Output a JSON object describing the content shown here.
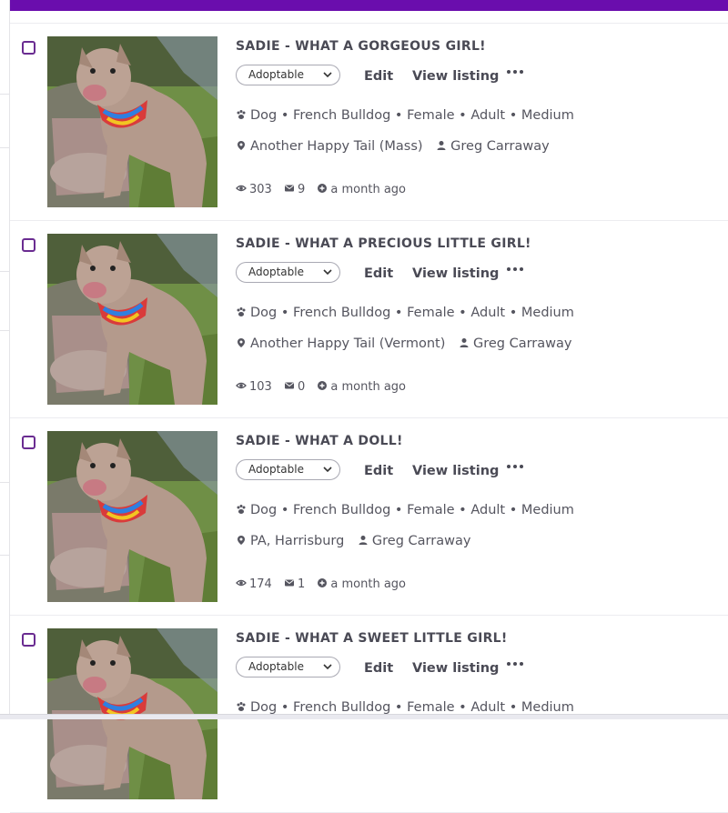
{
  "colors": {
    "accent": "#6a0dad",
    "checkbox": "#6a2c91",
    "text": "#4a4a55"
  },
  "actions": {
    "edit_label": "Edit",
    "view_label": "View listing",
    "more_icon": "ellipsis-icon"
  },
  "listings": [
    {
      "title": "SADIE - WHAT A GORGEOUS GIRL!",
      "status": "Adoptable",
      "species": "Dog",
      "breed": "French Bulldog",
      "sex": "Female",
      "age": "Adult",
      "size": "Medium",
      "location": "Another Happy Tail (Mass)",
      "contact": "Greg Carraway",
      "views": "303",
      "messages": "9",
      "posted": "a month ago"
    },
    {
      "title": "SADIE - WHAT A PRECIOUS LITTLE GIRL!",
      "status": "Adoptable",
      "species": "Dog",
      "breed": "French Bulldog",
      "sex": "Female",
      "age": "Adult",
      "size": "Medium",
      "location": "Another Happy Tail (Vermont)",
      "contact": "Greg Carraway",
      "views": "103",
      "messages": "0",
      "posted": "a month ago"
    },
    {
      "title": "SADIE - WHAT A DOLL!",
      "status": "Adoptable",
      "species": "Dog",
      "breed": "French Bulldog",
      "sex": "Female",
      "age": "Adult",
      "size": "Medium",
      "location": "PA, Harrisburg",
      "contact": "Greg Carraway",
      "views": "174",
      "messages": "1",
      "posted": "a month ago"
    },
    {
      "title": "SADIE - WHAT A SWEET LITTLE GIRL!",
      "status": "Adoptable",
      "species": "Dog",
      "breed": "French Bulldog",
      "sex": "Female",
      "age": "Adult",
      "size": "Medium"
    }
  ]
}
